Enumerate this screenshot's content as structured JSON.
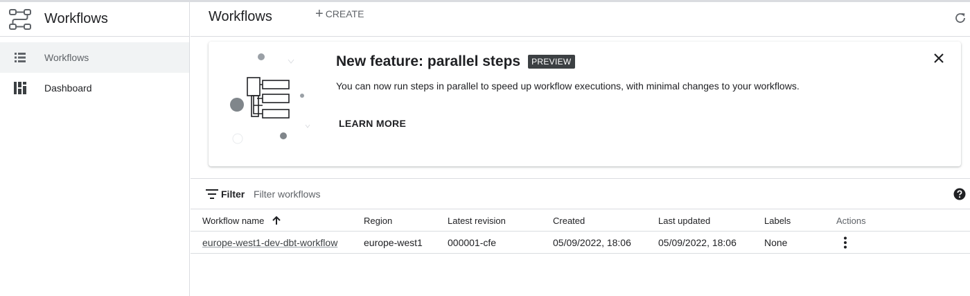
{
  "app": {
    "title": "Workflows"
  },
  "sidebar": {
    "items": [
      {
        "label": "Workflows",
        "icon": "list-icon",
        "active": true
      },
      {
        "label": "Dashboard",
        "icon": "dashboard-icon",
        "active": false
      }
    ]
  },
  "header": {
    "title": "Workflows",
    "create_label": "CREATE"
  },
  "banner": {
    "title": "New feature: parallel steps",
    "badge": "PREVIEW",
    "text": "You can now run steps in parallel to speed up workflow executions, with minimal changes to your workflows.",
    "learn_more": "LEARN MORE"
  },
  "filter": {
    "label": "Filter",
    "placeholder": "Filter workflows"
  },
  "table": {
    "columns": [
      "Workflow name",
      "Region",
      "Latest revision",
      "Created",
      "Last updated",
      "Labels",
      "Actions"
    ],
    "sort": {
      "column": "Workflow name",
      "direction": "ascending"
    },
    "rows": [
      {
        "name": "europe-west1-dev-dbt-workflow",
        "region": "europe-west1",
        "revision": "000001-cfe",
        "created": "05/09/2022, 18:06",
        "updated": "05/09/2022, 18:06",
        "labels": "None"
      }
    ]
  },
  "colors": {
    "text": "#202124",
    "muted": "#5f6368",
    "divider": "#dadce0",
    "active_nav_bg": "#f1f3f4",
    "badge_bg": "#3c4043"
  }
}
